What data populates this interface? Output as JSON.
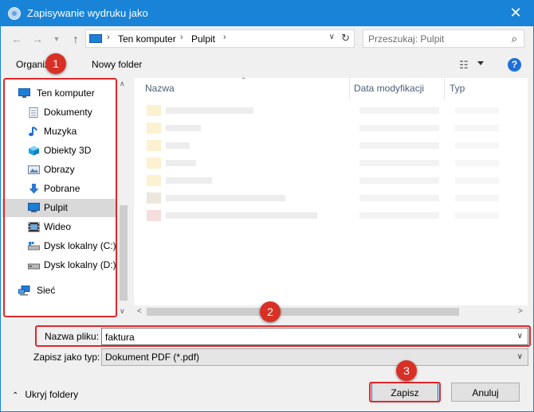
{
  "window": {
    "title": "Zapisywanie wydruku jako",
    "close": "✕"
  },
  "address": {
    "crumbs": [
      "Ten komputer",
      "Pulpit"
    ]
  },
  "search": {
    "placeholder": "Przeszukaj: Pulpit"
  },
  "toolbar": {
    "organize": "Organizuj",
    "new_folder": "Nowy folder",
    "help": "?"
  },
  "nav_pane": {
    "items": [
      {
        "label": "Ten komputer",
        "icon": "computer-icon"
      },
      {
        "label": "Dokumenty",
        "icon": "documents-icon"
      },
      {
        "label": "Muzyka",
        "icon": "music-icon"
      },
      {
        "label": "Obiekty 3D",
        "icon": "objects-3d-icon"
      },
      {
        "label": "Obrazy",
        "icon": "pictures-icon"
      },
      {
        "label": "Pobrane",
        "icon": "downloads-icon"
      },
      {
        "label": "Pulpit",
        "icon": "desktop-icon",
        "selected": true
      },
      {
        "label": "Wideo",
        "icon": "video-icon"
      },
      {
        "label": "Dysk lokalny (C:)",
        "icon": "drive-icon"
      },
      {
        "label": "Dysk lokalny (D:)",
        "icon": "drive-icon"
      },
      {
        "label": "Sieć",
        "icon": "network-icon"
      }
    ]
  },
  "file_list": {
    "columns": [
      "Nazwa",
      "Data modyfikacji",
      "Typ"
    ]
  },
  "form": {
    "filename_label": "Nazwa pliku:",
    "filename_value": "faktura",
    "filetype_label": "Zapisz jako typ:",
    "filetype_value": "Dokument PDF (*.pdf)"
  },
  "footer": {
    "hide_folders": "Ukryj foldery",
    "save": "Zapisz",
    "cancel": "Anuluj"
  },
  "annotations": {
    "markers": [
      "1",
      "2",
      "3"
    ],
    "color": "#e0262a"
  },
  "colors": {
    "titlebar": "#1883d7",
    "selected_nav": "#d9d9d9",
    "help": "#1e6fd9"
  }
}
